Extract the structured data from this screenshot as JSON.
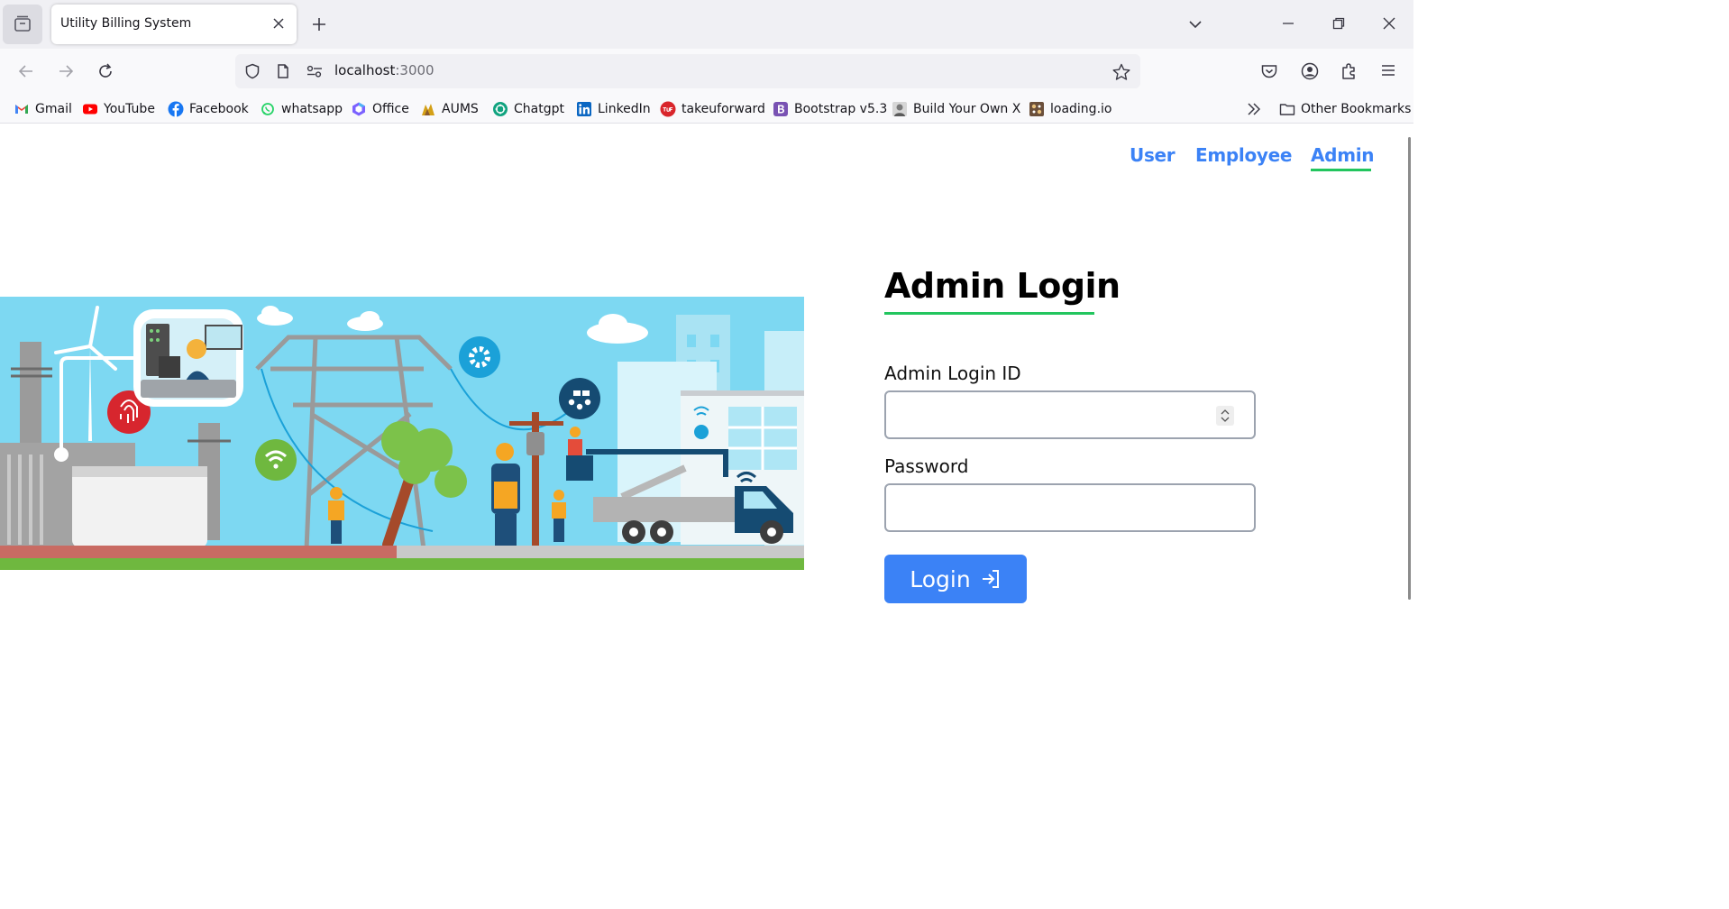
{
  "browser": {
    "tab": {
      "title": "Utility Billing System"
    },
    "url": {
      "host": "localhost",
      "port": ":3000"
    },
    "bookmarks": [
      {
        "label": "Gmail",
        "icon": "gmail-icon",
        "color": "#EA4335"
      },
      {
        "label": "YouTube",
        "icon": "youtube-icon",
        "color": "#FF0000"
      },
      {
        "label": "Facebook",
        "icon": "facebook-icon",
        "color": "#1877F2"
      },
      {
        "label": "whatsapp",
        "icon": "whatsapp-icon",
        "color": "#25D366"
      },
      {
        "label": "Office",
        "icon": "office-icon",
        "color": "#7B61FF"
      },
      {
        "label": "AUMS",
        "icon": "aums-icon",
        "color": "#B8860B"
      },
      {
        "label": "Chatgpt",
        "icon": "chatgpt-icon",
        "color": "#10A37F"
      },
      {
        "label": "LinkedIn",
        "icon": "linkedin-icon",
        "color": "#0A66C2"
      },
      {
        "label": "takeuforward",
        "icon": "takeuforward-icon",
        "color": "#D9252B"
      },
      {
        "label": "Bootstrap v5.3",
        "icon": "bootstrap-icon",
        "color": "#7952B3"
      },
      {
        "label": "Build Your Own X",
        "icon": "build-your-own-x-icon",
        "color": "#7A7A7A"
      },
      {
        "label": "loading.io",
        "icon": "loading-io-icon",
        "color": "#6B4F3A"
      }
    ],
    "other_bookmarks": "Other Bookmarks"
  },
  "page": {
    "nav": {
      "user": "User",
      "employee": "Employee",
      "admin": "Admin"
    },
    "login": {
      "title": "Admin Login",
      "id_label": "Admin Login ID",
      "id_value": "",
      "password_label": "Password",
      "password_value": "",
      "button": "Login"
    },
    "colors": {
      "accent": "#3B82F6",
      "underline": "#22C55E",
      "hero_sky": "#7DD8F2"
    }
  }
}
